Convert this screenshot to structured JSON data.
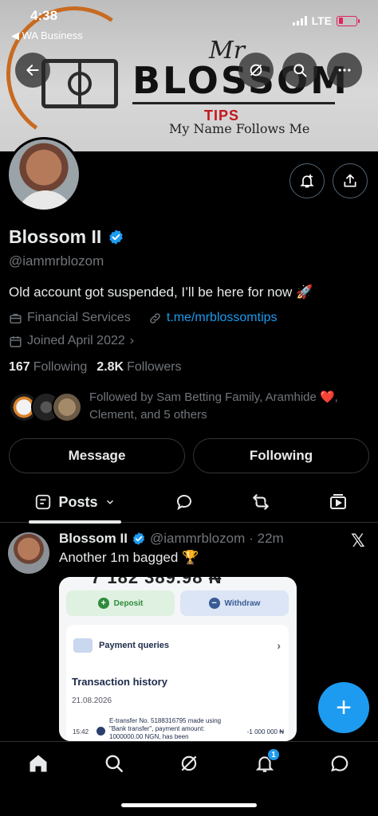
{
  "status_bar": {
    "time": "4:38",
    "back_app": "WA Business",
    "network": "LTE"
  },
  "banner": {
    "mr": "Mr",
    "brand": "BLOSSOM",
    "tips": "TIPS",
    "slogan": "My Name Follows Me"
  },
  "profile": {
    "display_name": "Blossom II",
    "handle": "@iammrblozom",
    "bio": "Old account got suspended, I’ll be here for now 🚀",
    "category": "Financial Services",
    "link": "t.me/mrblossomtips",
    "joined": "Joined April 2022",
    "following_count": "167",
    "following_label": "Following",
    "followers_count": "2.8K",
    "followers_label": "Followers",
    "followed_by": "Followed by Sam Betting Family, Aramhide ❤️, Clement, and 5 others",
    "message_button": "Message",
    "following_button": "Following"
  },
  "tabs": {
    "posts": "Posts"
  },
  "post": {
    "name": "Blossom II",
    "handle": "@iammrblozom",
    "time": "· 22m",
    "text": "Another 1m bagged 🏆",
    "media": {
      "amount_top": "7 182 389.98 ₦",
      "deposit": "Deposit",
      "withdraw": "Withdraw",
      "payment_queries": "Payment queries",
      "transaction_history": "Transaction history",
      "date": "21.08.2026",
      "tx_time": "15:42",
      "tx_desc": "E-transfer No. 5188316795 made using \"Bank transfer\", payment amount: 1000000.00 NGN, has been",
      "tx_amount": "-1 000 000 ₦"
    }
  },
  "bottom_nav": {
    "notifications_badge": "1"
  },
  "colors": {
    "accent": "#1d9bf0",
    "background": "#000000",
    "muted": "#71767b"
  }
}
